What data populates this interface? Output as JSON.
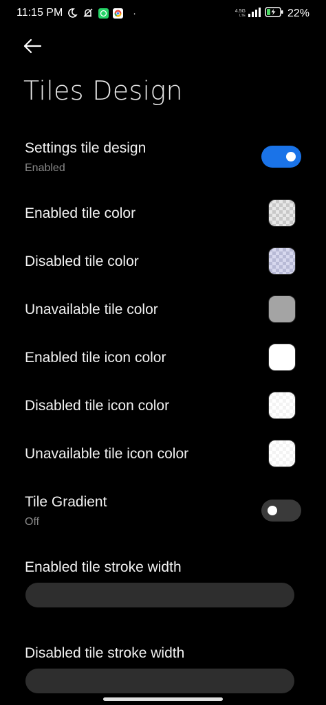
{
  "status_bar": {
    "time": "11:15 PM",
    "network_top": "4.5G",
    "network_bottom": "LTE",
    "battery_percent": "22%",
    "dot": "·",
    "icons": [
      "moon-icon",
      "muted-bell-icon",
      "whatsapp-icon",
      "chrome-icon",
      "signal-icon",
      "battery-charging-icon"
    ],
    "colors": {
      "whatsapp": "#25d366",
      "chrome_red": "#ea4335",
      "chrome_yellow": "#fbbc05",
      "chrome_green": "#34a853",
      "battery_charge": "#4cd964"
    }
  },
  "header": {
    "back_icon": "arrow-left-icon",
    "title": "Tiles Design"
  },
  "settings": {
    "tile_design": {
      "label": "Settings tile design",
      "status": "Enabled",
      "enabled": true
    },
    "enabled_tile_color": {
      "label": "Enabled tile color",
      "swatch": "checkerboard-gray"
    },
    "disabled_tile_color": {
      "label": "Disabled tile color",
      "swatch": "checkerboard-lavender"
    },
    "unavailable_tile_color": {
      "label": "Unavailable tile color",
      "swatch": "#a4a4a4"
    },
    "enabled_tile_icon_color": {
      "label": "Enabled tile icon color",
      "swatch": "#ffffff"
    },
    "disabled_tile_icon_color": {
      "label": "Disabled tile icon color",
      "swatch": "checkerboard-white"
    },
    "unavailable_tile_icon_color": {
      "label": "Unavailable tile icon color",
      "swatch": "checkerboard-white"
    },
    "tile_gradient": {
      "label": "Tile Gradient",
      "status": "Off",
      "enabled": false
    },
    "enabled_stroke_width": {
      "label": "Enabled tile stroke width"
    },
    "disabled_stroke_width": {
      "label": "Disabled tile stroke width"
    }
  },
  "accent_color": "#1a73e8"
}
